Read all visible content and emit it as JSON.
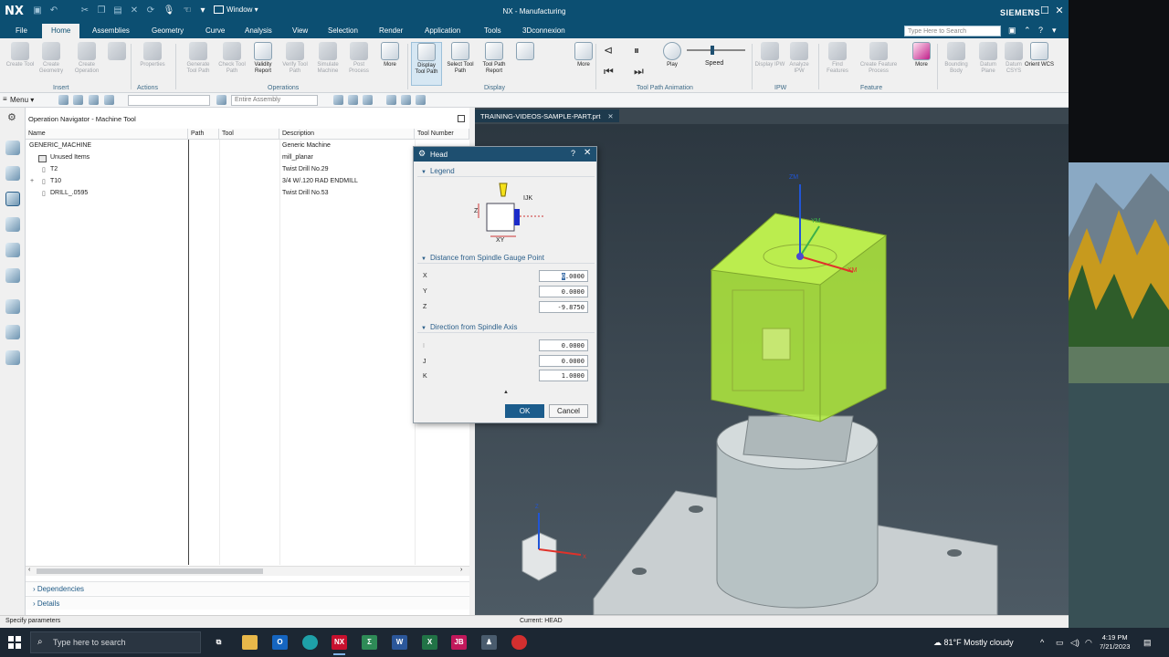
{
  "app": {
    "logo": "NX",
    "window_menu": "Window ▾",
    "title": "NX - Manufacturing",
    "brand": "SIEMENS"
  },
  "menu": {
    "items": [
      "File",
      "Home",
      "Assemblies",
      "Geometry",
      "Curve",
      "Analysis",
      "View",
      "Selection",
      "Render",
      "Application",
      "Tools",
      "3Dconnexion"
    ],
    "active": "Home",
    "search_placeholder": "Type Here to Search"
  },
  "ribbon": {
    "buttons": [
      {
        "label": "Create Tool",
        "enabled": false
      },
      {
        "label": "Create Geometry",
        "enabled": false
      },
      {
        "label": "Create Operation",
        "enabled": false
      },
      {
        "label": "",
        "enabled": false
      },
      {
        "label": "Properties",
        "enabled": false
      },
      {
        "label": "Generate Tool Path",
        "enabled": false
      },
      {
        "label": "Check Tool Path",
        "enabled": false
      },
      {
        "label": "Validity Report",
        "enabled": true
      },
      {
        "label": "Verify Tool Path",
        "enabled": false
      },
      {
        "label": "Simulate Machine",
        "enabled": false
      },
      {
        "label": "Post Process",
        "enabled": false
      },
      {
        "label": "More",
        "enabled": true
      },
      {
        "label": "Display Tool Path",
        "enabled": true,
        "selected": true
      },
      {
        "label": "Select Tool Path",
        "enabled": true
      },
      {
        "label": "Tool Path Report",
        "enabled": true
      },
      {
        "label": "",
        "enabled": true
      },
      {
        "label": "More",
        "enabled": true
      },
      {
        "label": "Play",
        "enabled": true
      },
      {
        "label": "Speed",
        "enabled": true
      },
      {
        "label": "Display IPW",
        "enabled": false
      },
      {
        "label": "Analyze IPW",
        "enabled": false
      },
      {
        "label": "Find Features",
        "enabled": false
      },
      {
        "label": "Create Feature Process",
        "enabled": false
      },
      {
        "label": "More",
        "enabled": true
      },
      {
        "label": "Bounding Body",
        "enabled": false
      },
      {
        "label": "Datum Plane",
        "enabled": false
      },
      {
        "label": "Datum CSYS",
        "enabled": false
      },
      {
        "label": "Orient WCS",
        "enabled": true
      }
    ],
    "groups": [
      "Insert",
      "Actions",
      "Operations",
      "Display",
      "Tool Path Animation",
      "IPW",
      "Feature"
    ]
  },
  "toolbar2": {
    "menu_label": "Menu ▾",
    "filter_dropdown": "",
    "scope_dropdown": "Entire Assembly"
  },
  "navigator": {
    "title": "Operation Navigator - Machine Tool",
    "columns": [
      "Name",
      "Path",
      "Tool",
      "Description",
      "Tool Number"
    ],
    "rows": [
      {
        "name": "GENERIC_MACHINE",
        "description": "Generic Machine"
      },
      {
        "name": "Unused Items",
        "description": "mill_planar"
      },
      {
        "name": "T2",
        "description": "Twist Drill No.29"
      },
      {
        "name": "T10",
        "description": "3/4 W/.120 RAD ENDMILL"
      },
      {
        "name": "DRILL_.0595",
        "description": "Twist Drill No.53"
      }
    ],
    "panels": [
      "Dependencies",
      "Details"
    ]
  },
  "viewport": {
    "tab_label": "TRAINING-VIDEOS-SAMPLE-PART.prt",
    "triad_labels": [
      "ZM",
      "YM",
      "XM"
    ],
    "mini_triad_labels": [
      "Z",
      "X"
    ]
  },
  "dialog": {
    "title": "Head",
    "sections": {
      "legend": "Legend",
      "distance": "Distance from Spindle Gauge Point",
      "direction": "Direction from Spindle Axis"
    },
    "legend_labels": {
      "ijk": "IJK",
      "z": "Z",
      "xy": "XY"
    },
    "distance_fields": [
      {
        "label": "X",
        "value": "0.0000",
        "selected_prefix": "0"
      },
      {
        "label": "Y",
        "value": "0.0000"
      },
      {
        "label": "Z",
        "value": "-9.8750"
      }
    ],
    "direction_fields": [
      {
        "label": "I",
        "value": "0.0000"
      },
      {
        "label": "J",
        "value": "0.0000"
      },
      {
        "label": "K",
        "value": "1.0000"
      }
    ],
    "ok": "OK",
    "cancel": "Cancel"
  },
  "status": {
    "left": "Specify parameters",
    "mid": "Current: HEAD"
  },
  "taskbar": {
    "search_placeholder": "Type here to search",
    "weather": "81°F  Mostly cloudy",
    "time": "4:19 PM",
    "date": "7/21/2023",
    "apps": [
      "task-view",
      "file-explorer",
      "outlook",
      "edge",
      "nx",
      "sigma",
      "word",
      "excel",
      "jb",
      "app",
      "chrome"
    ]
  },
  "colors": {
    "title_blue": "#0c4f72",
    "viewport_bg": "#3b4750",
    "part_green": "#b6f23c",
    "ok_blue": "#1b5c8c"
  }
}
